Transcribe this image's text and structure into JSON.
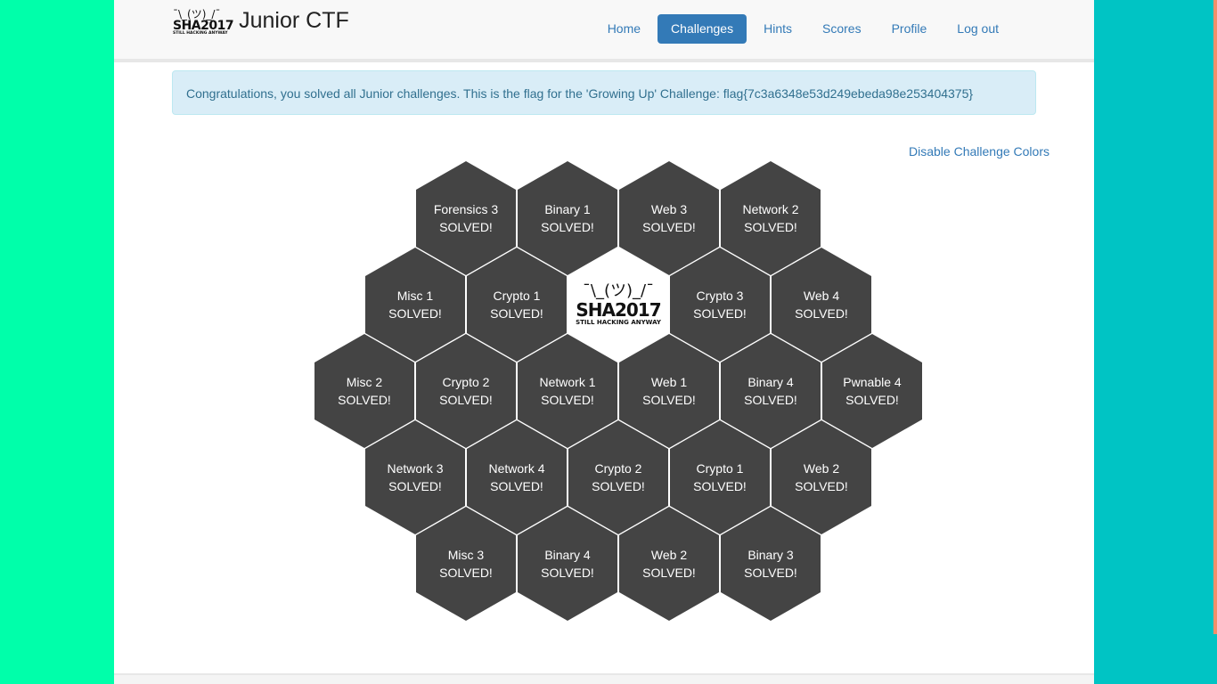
{
  "brand": {
    "logo_shrug": "¯\\_(ツ)_/¯",
    "logo_text": "SHA2017",
    "logo_subtext": "STILL HACKING ANYWAY",
    "title": "Junior CTF"
  },
  "nav": {
    "home": "Home",
    "challenges": "Challenges",
    "hints": "Hints",
    "scores": "Scores",
    "profile": "Profile",
    "logout": "Log out",
    "active": "Challenges"
  },
  "alert": {
    "message": "Congratulations, you solved all Junior challenges. This is the flag for the 'Growing Up' Challenge: flag{7c3a6348e53d249ebeda98e253404375}"
  },
  "toggle_colors_label": "Disable Challenge Colors",
  "center_logo": {
    "shrug": "¯\\_(ツ)_/¯",
    "text": "SHA2017",
    "subtext": "STILL HACKING ANYWAY"
  },
  "colors": {
    "hex_bg": "#444444",
    "primary": "#337ab7",
    "alert_bg": "#d9edf7",
    "alert_text": "#31708f"
  },
  "challenges": [
    {
      "name": "Forensics 3",
      "status": "SOLVED!"
    },
    {
      "name": "Binary 1",
      "status": "SOLVED!"
    },
    {
      "name": "Web 3",
      "status": "SOLVED!"
    },
    {
      "name": "Network 2",
      "status": "SOLVED!"
    },
    {
      "name": "Misc 1",
      "status": "SOLVED!"
    },
    {
      "name": "Crypto 1",
      "status": "SOLVED!"
    },
    {
      "name": "Crypto 3",
      "status": "SOLVED!"
    },
    {
      "name": "Web 4",
      "status": "SOLVED!"
    },
    {
      "name": "Misc 2",
      "status": "SOLVED!"
    },
    {
      "name": "Crypto 2",
      "status": "SOLVED!"
    },
    {
      "name": "Network 1",
      "status": "SOLVED!"
    },
    {
      "name": "Web 1",
      "status": "SOLVED!"
    },
    {
      "name": "Binary 4",
      "status": "SOLVED!"
    },
    {
      "name": "Pwnable 4",
      "status": "SOLVED!"
    },
    {
      "name": "Network 3",
      "status": "SOLVED!"
    },
    {
      "name": "Network 4",
      "status": "SOLVED!"
    },
    {
      "name": "Crypto 2",
      "status": "SOLVED!"
    },
    {
      "name": "Crypto 1",
      "status": "SOLVED!"
    },
    {
      "name": "Web 2",
      "status": "SOLVED!"
    },
    {
      "name": "Misc 3",
      "status": "SOLVED!"
    },
    {
      "name": "Binary 4",
      "status": "SOLVED!"
    },
    {
      "name": "Web 2",
      "status": "SOLVED!"
    },
    {
      "name": "Binary 3",
      "status": "SOLVED!"
    }
  ]
}
